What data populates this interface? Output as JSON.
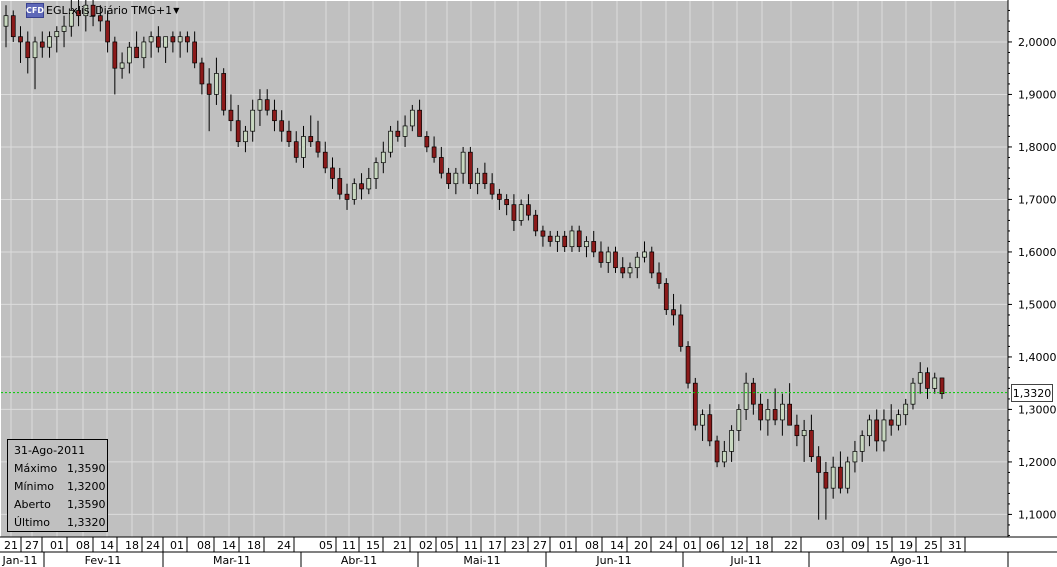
{
  "window": {
    "title": "EGL:xlis_Diário TMG+1"
  },
  "info_panel": {
    "date": "31-Ago-2011",
    "rows": [
      {
        "label": "Máximo",
        "value": "1,3590"
      },
      {
        "label": "Mínimo",
        "value": "1,3200"
      },
      {
        "label": "Aberto",
        "value": "1,3590"
      },
      {
        "label": "Último",
        "value": "1,3320"
      }
    ]
  },
  "last_price_label": "1,3320",
  "colors": {
    "background": "#c0c0c0",
    "grid": "#dcdcdc",
    "up": "#c8d8c0",
    "down": "#8b1a1a",
    "last_line": "#00cc00"
  },
  "chart_data": {
    "type": "candlestick",
    "title": "EGL:xlis_Diário TMG+1",
    "y_ticks": [
      "2,0000",
      "1,9000",
      "1,8000",
      "1,7000",
      "1,6000",
      "1,5000",
      "1,4000",
      "1,3000",
      "1,2000",
      "1,1000"
    ],
    "y_tick_values": [
      2.0,
      1.9,
      1.8,
      1.7,
      1.6,
      1.5,
      1.4,
      1.3,
      1.2,
      1.1
    ],
    "ylim": [
      1.057,
      2.078
    ],
    "x_tick_labels": [
      "21",
      "27",
      "01",
      "08",
      "14",
      "18",
      "24",
      "01",
      "08",
      "14",
      "18",
      "24",
      "05",
      "11",
      "15",
      "21",
      "02",
      "05",
      "11",
      "17",
      "23",
      "27",
      "01",
      "08",
      "14",
      "20",
      "24",
      "01",
      "06",
      "12",
      "18",
      "22",
      "03",
      "09",
      "15",
      "19",
      "25",
      "31"
    ],
    "month_labels": [
      "Jan-11",
      "Fev-11",
      "Mar-11",
      "Abr-11",
      "Mai-11",
      "Jun-11",
      "Jul-11",
      "Ago-11"
    ],
    "last_value": 1.332,
    "grid": true,
    "ohlc": [
      [
        2.03,
        2.07,
        1.99,
        2.05
      ],
      [
        2.05,
        2.06,
        2.0,
        2.01
      ],
      [
        2.01,
        2.03,
        1.96,
        2.0
      ],
      [
        2.0,
        2.02,
        1.94,
        1.97
      ],
      [
        1.97,
        2.01,
        1.91,
        2.0
      ],
      [
        2.0,
        2.02,
        1.97,
        1.99
      ],
      [
        1.99,
        2.02,
        1.97,
        2.01
      ],
      [
        2.01,
        2.03,
        1.98,
        2.02
      ],
      [
        2.02,
        2.05,
        1.99,
        2.03
      ],
      [
        2.03,
        2.08,
        2.01,
        2.06
      ],
      [
        2.06,
        2.08,
        2.03,
        2.05
      ],
      [
        2.05,
        2.09,
        2.02,
        2.07
      ],
      [
        2.07,
        2.08,
        2.03,
        2.05
      ],
      [
        2.05,
        2.07,
        2.02,
        2.04
      ],
      [
        2.04,
        2.06,
        1.98,
        2.0
      ],
      [
        2.0,
        2.01,
        1.9,
        1.95
      ],
      [
        1.95,
        1.98,
        1.93,
        1.96
      ],
      [
        1.96,
        2.0,
        1.94,
        1.99
      ],
      [
        1.99,
        2.02,
        1.97,
        1.97
      ],
      [
        1.97,
        2.01,
        1.95,
        2.0
      ],
      [
        2.0,
        2.02,
        1.97,
        2.01
      ],
      [
        2.01,
        2.03,
        1.98,
        1.99
      ],
      [
        1.99,
        2.01,
        1.96,
        2.01
      ],
      [
        2.01,
        2.02,
        1.98,
        2.0
      ],
      [
        2.0,
        2.02,
        1.97,
        2.01
      ],
      [
        2.01,
        2.02,
        1.98,
        2.0
      ],
      [
        2.0,
        2.02,
        1.95,
        1.96
      ],
      [
        1.96,
        1.97,
        1.9,
        1.92
      ],
      [
        1.92,
        1.95,
        1.83,
        1.9
      ],
      [
        1.9,
        1.97,
        1.88,
        1.94
      ],
      [
        1.94,
        1.95,
        1.86,
        1.87
      ],
      [
        1.87,
        1.9,
        1.83,
        1.85
      ],
      [
        1.85,
        1.88,
        1.8,
        1.81
      ],
      [
        1.81,
        1.84,
        1.79,
        1.83
      ],
      [
        1.83,
        1.89,
        1.81,
        1.87
      ],
      [
        1.87,
        1.91,
        1.84,
        1.89
      ],
      [
        1.89,
        1.91,
        1.86,
        1.87
      ],
      [
        1.87,
        1.89,
        1.83,
        1.85
      ],
      [
        1.85,
        1.87,
        1.81,
        1.83
      ],
      [
        1.83,
        1.85,
        1.8,
        1.81
      ],
      [
        1.81,
        1.83,
        1.77,
        1.78
      ],
      [
        1.78,
        1.84,
        1.76,
        1.82
      ],
      [
        1.82,
        1.86,
        1.8,
        1.81
      ],
      [
        1.81,
        1.85,
        1.78,
        1.79
      ],
      [
        1.79,
        1.81,
        1.75,
        1.76
      ],
      [
        1.76,
        1.78,
        1.72,
        1.74
      ],
      [
        1.74,
        1.76,
        1.7,
        1.71
      ],
      [
        1.71,
        1.73,
        1.68,
        1.7
      ],
      [
        1.7,
        1.74,
        1.69,
        1.73
      ],
      [
        1.73,
        1.75,
        1.7,
        1.72
      ],
      [
        1.72,
        1.76,
        1.71,
        1.74
      ],
      [
        1.74,
        1.78,
        1.72,
        1.77
      ],
      [
        1.77,
        1.81,
        1.75,
        1.79
      ],
      [
        1.79,
        1.84,
        1.78,
        1.83
      ],
      [
        1.83,
        1.85,
        1.81,
        1.82
      ],
      [
        1.82,
        1.86,
        1.8,
        1.84
      ],
      [
        1.84,
        1.88,
        1.83,
        1.87
      ],
      [
        1.87,
        1.89,
        1.82,
        1.82
      ],
      [
        1.82,
        1.83,
        1.79,
        1.8
      ],
      [
        1.8,
        1.82,
        1.77,
        1.78
      ],
      [
        1.78,
        1.8,
        1.74,
        1.75
      ],
      [
        1.75,
        1.76,
        1.72,
        1.73
      ],
      [
        1.73,
        1.76,
        1.71,
        1.75
      ],
      [
        1.75,
        1.8,
        1.73,
        1.79
      ],
      [
        1.79,
        1.8,
        1.72,
        1.73
      ],
      [
        1.73,
        1.76,
        1.71,
        1.75
      ],
      [
        1.75,
        1.77,
        1.72,
        1.73
      ],
      [
        1.73,
        1.75,
        1.7,
        1.71
      ],
      [
        1.71,
        1.72,
        1.68,
        1.7
      ],
      [
        1.7,
        1.71,
        1.67,
        1.69
      ],
      [
        1.69,
        1.71,
        1.64,
        1.66
      ],
      [
        1.66,
        1.7,
        1.65,
        1.69
      ],
      [
        1.69,
        1.71,
        1.66,
        1.67
      ],
      [
        1.67,
        1.68,
        1.63,
        1.64
      ],
      [
        1.64,
        1.65,
        1.61,
        1.63
      ],
      [
        1.63,
        1.64,
        1.61,
        1.62
      ],
      [
        1.62,
        1.64,
        1.6,
        1.63
      ],
      [
        1.63,
        1.64,
        1.6,
        1.61
      ],
      [
        1.61,
        1.65,
        1.6,
        1.64
      ],
      [
        1.64,
        1.65,
        1.6,
        1.61
      ],
      [
        1.61,
        1.63,
        1.59,
        1.62
      ],
      [
        1.62,
        1.64,
        1.59,
        1.6
      ],
      [
        1.6,
        1.62,
        1.57,
        1.58
      ],
      [
        1.58,
        1.61,
        1.56,
        1.6
      ],
      [
        1.6,
        1.61,
        1.56,
        1.57
      ],
      [
        1.57,
        1.59,
        1.55,
        1.56
      ],
      [
        1.56,
        1.58,
        1.55,
        1.57
      ],
      [
        1.57,
        1.6,
        1.55,
        1.59
      ],
      [
        1.59,
        1.62,
        1.58,
        1.6
      ],
      [
        1.6,
        1.61,
        1.55,
        1.56
      ],
      [
        1.56,
        1.58,
        1.53,
        1.54
      ],
      [
        1.54,
        1.55,
        1.48,
        1.49
      ],
      [
        1.49,
        1.52,
        1.46,
        1.48
      ],
      [
        1.48,
        1.5,
        1.41,
        1.42
      ],
      [
        1.42,
        1.43,
        1.34,
        1.35
      ],
      [
        1.35,
        1.36,
        1.26,
        1.27
      ],
      [
        1.27,
        1.3,
        1.24,
        1.29
      ],
      [
        1.29,
        1.31,
        1.23,
        1.24
      ],
      [
        1.24,
        1.25,
        1.19,
        1.2
      ],
      [
        1.2,
        1.24,
        1.19,
        1.22
      ],
      [
        1.22,
        1.27,
        1.2,
        1.26
      ],
      [
        1.26,
        1.31,
        1.24,
        1.3
      ],
      [
        1.3,
        1.37,
        1.28,
        1.35
      ],
      [
        1.35,
        1.36,
        1.29,
        1.31
      ],
      [
        1.31,
        1.33,
        1.26,
        1.28
      ],
      [
        1.28,
        1.32,
        1.25,
        1.3
      ],
      [
        1.3,
        1.34,
        1.27,
        1.28
      ],
      [
        1.28,
        1.33,
        1.25,
        1.31
      ],
      [
        1.31,
        1.35,
        1.27,
        1.27
      ],
      [
        1.27,
        1.29,
        1.23,
        1.25
      ],
      [
        1.25,
        1.28,
        1.2,
        1.26
      ],
      [
        1.26,
        1.29,
        1.2,
        1.21
      ],
      [
        1.21,
        1.23,
        1.09,
        1.18
      ],
      [
        1.18,
        1.2,
        1.09,
        1.15
      ],
      [
        1.15,
        1.21,
        1.13,
        1.19
      ],
      [
        1.19,
        1.22,
        1.14,
        1.15
      ],
      [
        1.15,
        1.21,
        1.14,
        1.2
      ],
      [
        1.2,
        1.24,
        1.18,
        1.22
      ],
      [
        1.22,
        1.26,
        1.2,
        1.25
      ],
      [
        1.25,
        1.29,
        1.23,
        1.28
      ],
      [
        1.28,
        1.3,
        1.22,
        1.24
      ],
      [
        1.24,
        1.3,
        1.22,
        1.28
      ],
      [
        1.28,
        1.31,
        1.25,
        1.27
      ],
      [
        1.27,
        1.3,
        1.26,
        1.29
      ],
      [
        1.29,
        1.32,
        1.27,
        1.31
      ],
      [
        1.31,
        1.36,
        1.3,
        1.35
      ],
      [
        1.35,
        1.39,
        1.33,
        1.37
      ],
      [
        1.37,
        1.38,
        1.32,
        1.34
      ],
      [
        1.34,
        1.37,
        1.33,
        1.36
      ],
      [
        1.36,
        1.36,
        1.32,
        1.33
      ]
    ]
  }
}
